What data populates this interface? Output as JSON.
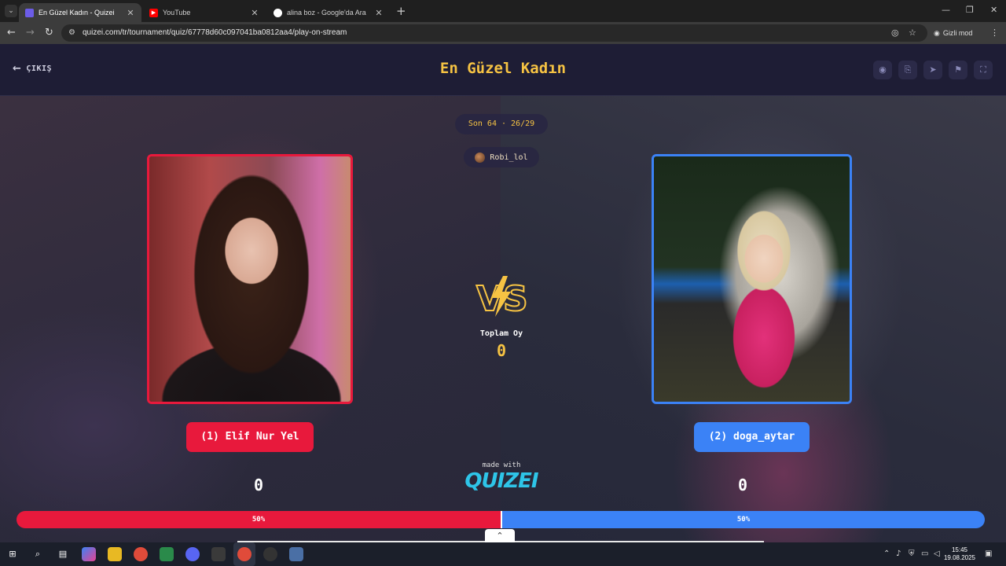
{
  "browser": {
    "tabs": [
      {
        "title": "En Güzel Kadın - Quizei",
        "active": true
      },
      {
        "title": "YouTube",
        "active": false
      },
      {
        "title": "alina boz - Google'da Ara",
        "active": false
      }
    ],
    "url": "quizei.com/tr/tournament/quiz/67778d60c097041ba0812aa4/play-on-stream",
    "incognito_label": "Gizli mod"
  },
  "header": {
    "exit_label": "ÇIKIŞ",
    "title": "En Güzel Kadın"
  },
  "round": {
    "label": "Son 64 · 26/29",
    "streamer": "Robi_lol"
  },
  "center": {
    "vs_text": "VS",
    "total_votes_label": "Toplam Oy",
    "total_votes": "0",
    "made_with": "made with",
    "brand": "QUIZEI"
  },
  "contestants": [
    {
      "label": "(1) Elif Nur Yel",
      "votes": "0",
      "percent_label": "50%",
      "percent": 50,
      "color": "#e8193c"
    },
    {
      "label": "(2) doga_aytar",
      "votes": "0",
      "percent_label": "50%",
      "percent": 50,
      "color": "#3b82f6"
    }
  ],
  "taskbar": {
    "time": "15:45",
    "date": "19.08.2025"
  },
  "colors": {
    "accent": "#f6c343",
    "left": "#e8193c",
    "right": "#3b82f6",
    "brand": "#2ec5e8"
  }
}
